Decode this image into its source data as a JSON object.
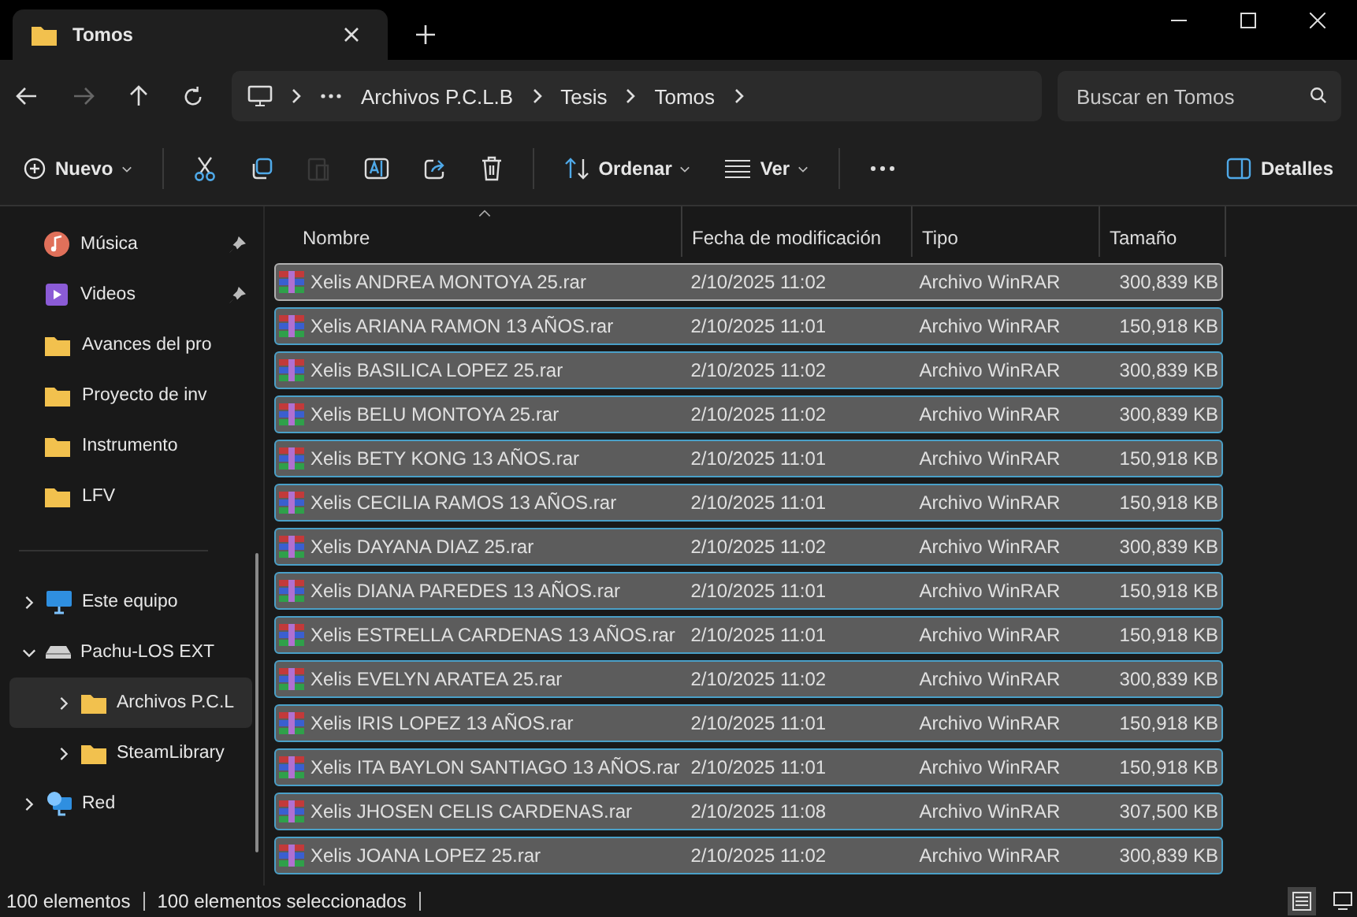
{
  "tab": {
    "title": "Tomos"
  },
  "nav": {
    "breadcrumb": [
      "Archivos P.C.L.B",
      "Tesis",
      "Tomos"
    ],
    "search": {
      "placeholder": "Buscar en Tomos"
    }
  },
  "toolbar": [
    {
      "kind": "new",
      "label": "Nuevo",
      "disabled": false
    },
    {
      "kind": "cut",
      "disabled": false
    },
    {
      "kind": "copy",
      "disabled": false
    },
    {
      "kind": "paste",
      "disabled": true
    },
    {
      "kind": "rename",
      "disabled": false
    },
    {
      "kind": "share",
      "disabled": false
    },
    {
      "kind": "delete",
      "disabled": false
    },
    {
      "kind": "sort",
      "label": "Ordenar",
      "disabled": false
    },
    {
      "kind": "view",
      "label": "Ver",
      "disabled": false
    },
    {
      "kind": "more",
      "disabled": false
    },
    {
      "kind": "details",
      "label": "Detalles",
      "disabled": false
    }
  ],
  "sidebar": {
    "quick": [
      {
        "kind": "music",
        "label": "Música",
        "pinned": true
      },
      {
        "kind": "video",
        "label": "Videos",
        "pinned": true
      },
      {
        "kind": "folder",
        "label": "Avances del pro",
        "pinned": false
      },
      {
        "kind": "folder",
        "label": "Proyecto de inv",
        "pinned": false
      },
      {
        "kind": "folder",
        "label": "Instrumento",
        "pinned": false
      },
      {
        "kind": "folder",
        "label": "LFV",
        "pinned": false
      }
    ],
    "tree": [
      {
        "kind": "pc",
        "label": "Este equipo",
        "expanded": false,
        "selected": false
      },
      {
        "kind": "drive",
        "label": "Pachu-LOS EXT",
        "expanded": true,
        "selected": false,
        "children": [
          {
            "kind": "folder",
            "label": "Archivos P.C.L",
            "expanded": false,
            "selected": true
          },
          {
            "kind": "folder",
            "label": "SteamLibrary",
            "expanded": false,
            "selected": false
          }
        ]
      },
      {
        "kind": "network",
        "label": "Red",
        "expanded": false,
        "selected": false
      }
    ]
  },
  "table": {
    "columns": [
      {
        "label": "Nombre",
        "sorted": true
      },
      {
        "label": "Fecha de modificación",
        "sorted": false
      },
      {
        "label": "Tipo",
        "sorted": false
      },
      {
        "label": "Tamaño",
        "sorted": false
      }
    ],
    "rows": [
      {
        "name": "Xelis  ANDREA MONTOYA 25.rar",
        "date": "2/10/2025 11:02",
        "type": "Archivo WinRAR",
        "size": "300,839 KB",
        "selected": true,
        "focused": true
      },
      {
        "name": "Xelis  ARIANA RAMON 13 AÑOS.rar",
        "date": "2/10/2025 11:01",
        "type": "Archivo WinRAR",
        "size": "150,918 KB",
        "selected": true,
        "focused": false
      },
      {
        "name": "Xelis  BASILICA LOPEZ 25.rar",
        "date": "2/10/2025 11:02",
        "type": "Archivo WinRAR",
        "size": "300,839 KB",
        "selected": true,
        "focused": false
      },
      {
        "name": "Xelis  BELU MONTOYA 25.rar",
        "date": "2/10/2025 11:02",
        "type": "Archivo WinRAR",
        "size": "300,839 KB",
        "selected": true,
        "focused": false
      },
      {
        "name": "Xelis  BETY KONG 13 AÑOS.rar",
        "date": "2/10/2025 11:01",
        "type": "Archivo WinRAR",
        "size": "150,918 KB",
        "selected": true,
        "focused": false
      },
      {
        "name": "Xelis  CECILIA RAMOS 13 AÑOS.rar",
        "date": "2/10/2025 11:01",
        "type": "Archivo WinRAR",
        "size": "150,918 KB",
        "selected": true,
        "focused": false
      },
      {
        "name": "Xelis  DAYANA DIAZ 25.rar",
        "date": "2/10/2025 11:02",
        "type": "Archivo WinRAR",
        "size": "300,839 KB",
        "selected": true,
        "focused": false
      },
      {
        "name": "Xelis  DIANA PAREDES 13 AÑOS.rar",
        "date": "2/10/2025 11:01",
        "type": "Archivo WinRAR",
        "size": "150,918 KB",
        "selected": true,
        "focused": false
      },
      {
        "name": "Xelis  ESTRELLA CARDENAS 13 AÑOS.rar",
        "date": "2/10/2025 11:01",
        "type": "Archivo WinRAR",
        "size": "150,918 KB",
        "selected": true,
        "focused": false
      },
      {
        "name": "Xelis  EVELYN ARATEA 25.rar",
        "date": "2/10/2025 11:02",
        "type": "Archivo WinRAR",
        "size": "300,839 KB",
        "selected": true,
        "focused": false
      },
      {
        "name": "Xelis  IRIS LOPEZ 13 AÑOS.rar",
        "date": "2/10/2025 11:01",
        "type": "Archivo WinRAR",
        "size": "150,918 KB",
        "selected": true,
        "focused": false
      },
      {
        "name": "Xelis  ITA BAYLON SANTIAGO 13 AÑOS.rar",
        "date": "2/10/2025 11:01",
        "type": "Archivo WinRAR",
        "size": "150,918 KB",
        "selected": true,
        "focused": false
      },
      {
        "name": "Xelis  JHOSEN CELIS CARDENAS.rar",
        "date": "2/10/2025 11:08",
        "type": "Archivo WinRAR",
        "size": "307,500 KB",
        "selected": true,
        "focused": false
      },
      {
        "name": "Xelis  JOANA LOPEZ 25.rar",
        "date": "2/10/2025 11:02",
        "type": "Archivo WinRAR",
        "size": "300,839 KB",
        "selected": true,
        "focused": false
      }
    ]
  },
  "status_bar": {
    "count": "100 elementos",
    "selection": "100 elementos seleccionados",
    "views": [
      {
        "kind": "details",
        "selected": true
      },
      {
        "kind": "tiles",
        "selected": false
      }
    ]
  }
}
